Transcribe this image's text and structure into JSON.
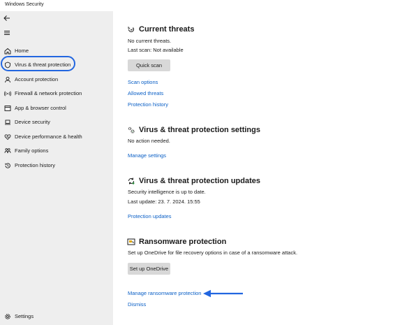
{
  "window": {
    "title": "Windows Security"
  },
  "sidebar": {
    "items": [
      {
        "label": "Home",
        "icon": "home-icon"
      },
      {
        "label": "Virus & threat protection",
        "icon": "shield-icon",
        "active": true
      },
      {
        "label": "Account protection",
        "icon": "person-icon"
      },
      {
        "label": "Firewall & network protection",
        "icon": "wifi-icon"
      },
      {
        "label": "App & browser control",
        "icon": "browser-window-icon"
      },
      {
        "label": "Device security",
        "icon": "laptop-icon"
      },
      {
        "label": "Device performance & health",
        "icon": "heart-icon"
      },
      {
        "label": "Family options",
        "icon": "family-icon"
      },
      {
        "label": "Protection history",
        "icon": "history-icon"
      }
    ],
    "settings_label": "Settings"
  },
  "current_threats": {
    "title": "Current threats",
    "status": "No current threats.",
    "last_scan": "Last scan: Not available",
    "quick_scan_label": "Quick scan",
    "links": [
      "Scan options",
      "Allowed threats",
      "Protection history"
    ]
  },
  "protection_settings": {
    "title": "Virus & threat protection settings",
    "status": "No action needed.",
    "link": "Manage settings"
  },
  "protection_updates": {
    "title": "Virus & threat protection updates",
    "status": "Security intelligence is up to date.",
    "last_update": "Last update: 23. 7. 2024. 15:55",
    "link": "Protection updates"
  },
  "ransomware": {
    "title": "Ransomware protection",
    "description": "Set up OneDrive for file recovery options in case of a ransomware attack.",
    "setup_label": "Set up OneDrive",
    "manage_link": "Manage ransomware protection",
    "dismiss_link": "Dismiss"
  },
  "colors": {
    "accent": "#0a5fc6",
    "highlight": "#2266e0",
    "sidebar_bg": "#eeeeee",
    "button_bg": "#d8d8d8"
  }
}
